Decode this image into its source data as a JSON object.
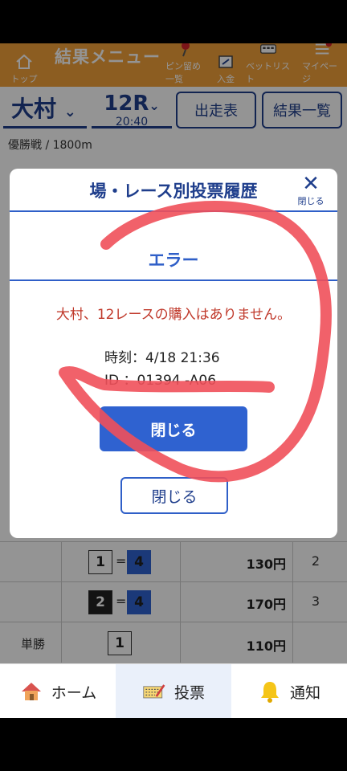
{
  "header": {
    "title": "結果メニュー",
    "items": [
      {
        "label": "トップ",
        "icon": "home-icon"
      },
      {
        "label": "ピン留め一覧",
        "icon": "pin-icon"
      },
      {
        "label": "入金",
        "icon": "deposit-icon"
      },
      {
        "label": "ベットリスト",
        "icon": "betlist-icon"
      },
      {
        "label": "マイページ",
        "icon": "menu-icon"
      }
    ]
  },
  "race_selector": {
    "venue": "大村",
    "race_no": "12R",
    "race_time": "20:40",
    "entries_button": "出走表",
    "results_button": "結果一覧"
  },
  "race_info": "優勝戦 / 1800m",
  "history_modal": {
    "title": "場・レース別投票履歴",
    "close_label": "閉じる",
    "close_button": "閉じる"
  },
  "results_table": {
    "rows": [
      {
        "label": "",
        "boats": [
          "1",
          "4"
        ],
        "payout": "130円",
        "rank": "2"
      },
      {
        "label": "",
        "boats": [
          "2",
          "4"
        ],
        "payout": "170円",
        "rank": "3"
      },
      {
        "label": "単勝",
        "boats": [
          "1"
        ],
        "payout": "110円",
        "rank": ""
      }
    ],
    "eq": "="
  },
  "error_dialog": {
    "title": "エラー",
    "message": "大村、12レースの購入はありません。",
    "time_line": "時刻：4/18 21:36",
    "id_line": "ID ：01394 -A06",
    "close_button": "閉じる"
  },
  "bottom_nav": {
    "items": [
      {
        "label": "ホーム",
        "icon": "house-icon"
      },
      {
        "label": "投票",
        "icon": "ticket-icon"
      },
      {
        "label": "通知",
        "icon": "bell-icon"
      }
    ]
  },
  "colors": {
    "header_bg": "#f2a13a",
    "primary_blue": "#1f3e8c",
    "button_blue": "#2f62d0",
    "error_red": "#c0392b",
    "scribble_red": "#f0505a"
  }
}
